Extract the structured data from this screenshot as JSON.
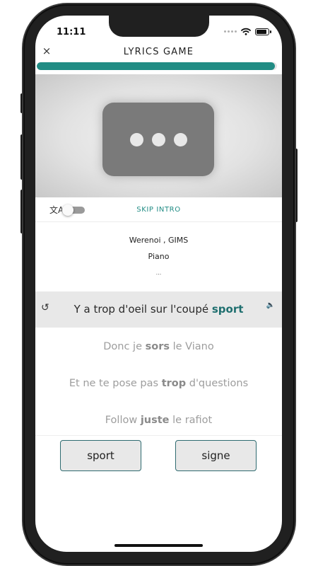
{
  "status_bar": {
    "time": "11:11"
  },
  "header": {
    "title": "LYRICS GAME",
    "close_symbol": "×",
    "progress": 0.99,
    "accent_color": "#218c84"
  },
  "video": {
    "icon": "ellipsis-loading-icon"
  },
  "controls": {
    "translate_icon": "文A",
    "translate_toggle_on": false,
    "skip_intro_label": "SKIP INTRO"
  },
  "song": {
    "artists": "Werenoi , GIMS",
    "title": "Piano",
    "ellipsis": "..."
  },
  "lyrics": {
    "current_line_prefix": "Y a trop d'oeil sur l'coupé ",
    "current_line_answer": "sport",
    "replay_icon": "↺",
    "speaker_icon": "🔈",
    "upcoming": [
      {
        "a": "Donc je ",
        "b": "sors",
        "c": " le Viano"
      },
      {
        "a": "Et ne te pose pas ",
        "b": "trop",
        "c": " d'questions"
      },
      {
        "a": "Follow ",
        "b": "juste",
        "c": " le rafiot"
      }
    ]
  },
  "answers": {
    "option_1": "sport",
    "option_2": "signe"
  }
}
